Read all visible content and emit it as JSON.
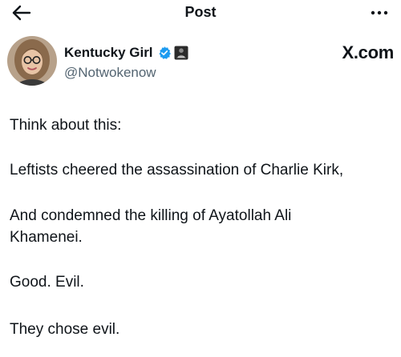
{
  "header": {
    "title": "Post",
    "back_icon": "arrow-left-icon",
    "more_icon": "more-horizontal-icon"
  },
  "author": {
    "name": "Kentucky Girl",
    "handle": "@Notwokenow",
    "verified_icon": "verified-badge-icon",
    "verified_color": "#1d9bf0",
    "affiliation_icon": "affiliation-badge-icon"
  },
  "source_label": "X.com",
  "tweet": {
    "line1": "Think about this:",
    "line2": "Leftists cheered the assassination of Charlie Kirk,",
    "line3a": "And condemned the killing of Ayatollah Ali",
    "line3b": "Khamenei.",
    "line4": "Good. Evil.",
    "line5": "They chose evil."
  }
}
